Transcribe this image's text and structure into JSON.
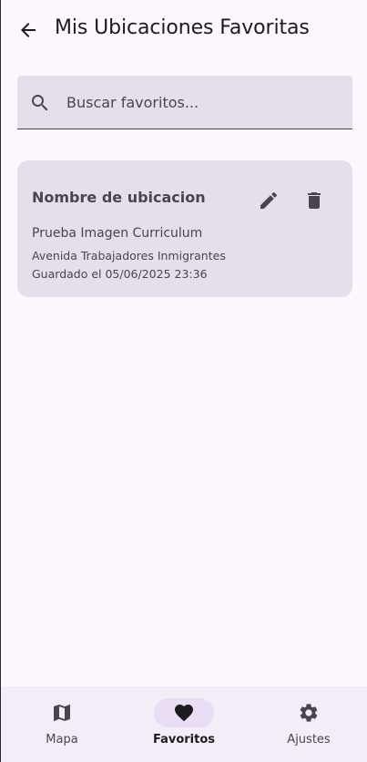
{
  "header": {
    "title": "Mis Ubicaciones Favoritas"
  },
  "search": {
    "placeholder": "Buscar favoritos...",
    "value": ""
  },
  "favorites": [
    {
      "name": "Nombre de ubicacion",
      "description": "Prueba Imagen Curriculum",
      "address": "Avenida Trabajadores Inmigrantes",
      "saved": "Guardado el 05/06/2025 23:36"
    }
  ],
  "bottom_nav": {
    "items": [
      {
        "label": "Mapa",
        "icon": "map-icon",
        "active": false
      },
      {
        "label": "Favoritos",
        "icon": "heart-icon",
        "active": true
      },
      {
        "label": "Ajustes",
        "icon": "gear-icon",
        "active": false
      }
    ]
  },
  "colors": {
    "background": "#FEF7FF",
    "surface_variant": "#E6DEEB",
    "nav_background": "#F2EDF6",
    "active_indicator": "#E8DDF5",
    "on_surface": "#1D1B20",
    "on_surface_variant": "#49454F"
  }
}
